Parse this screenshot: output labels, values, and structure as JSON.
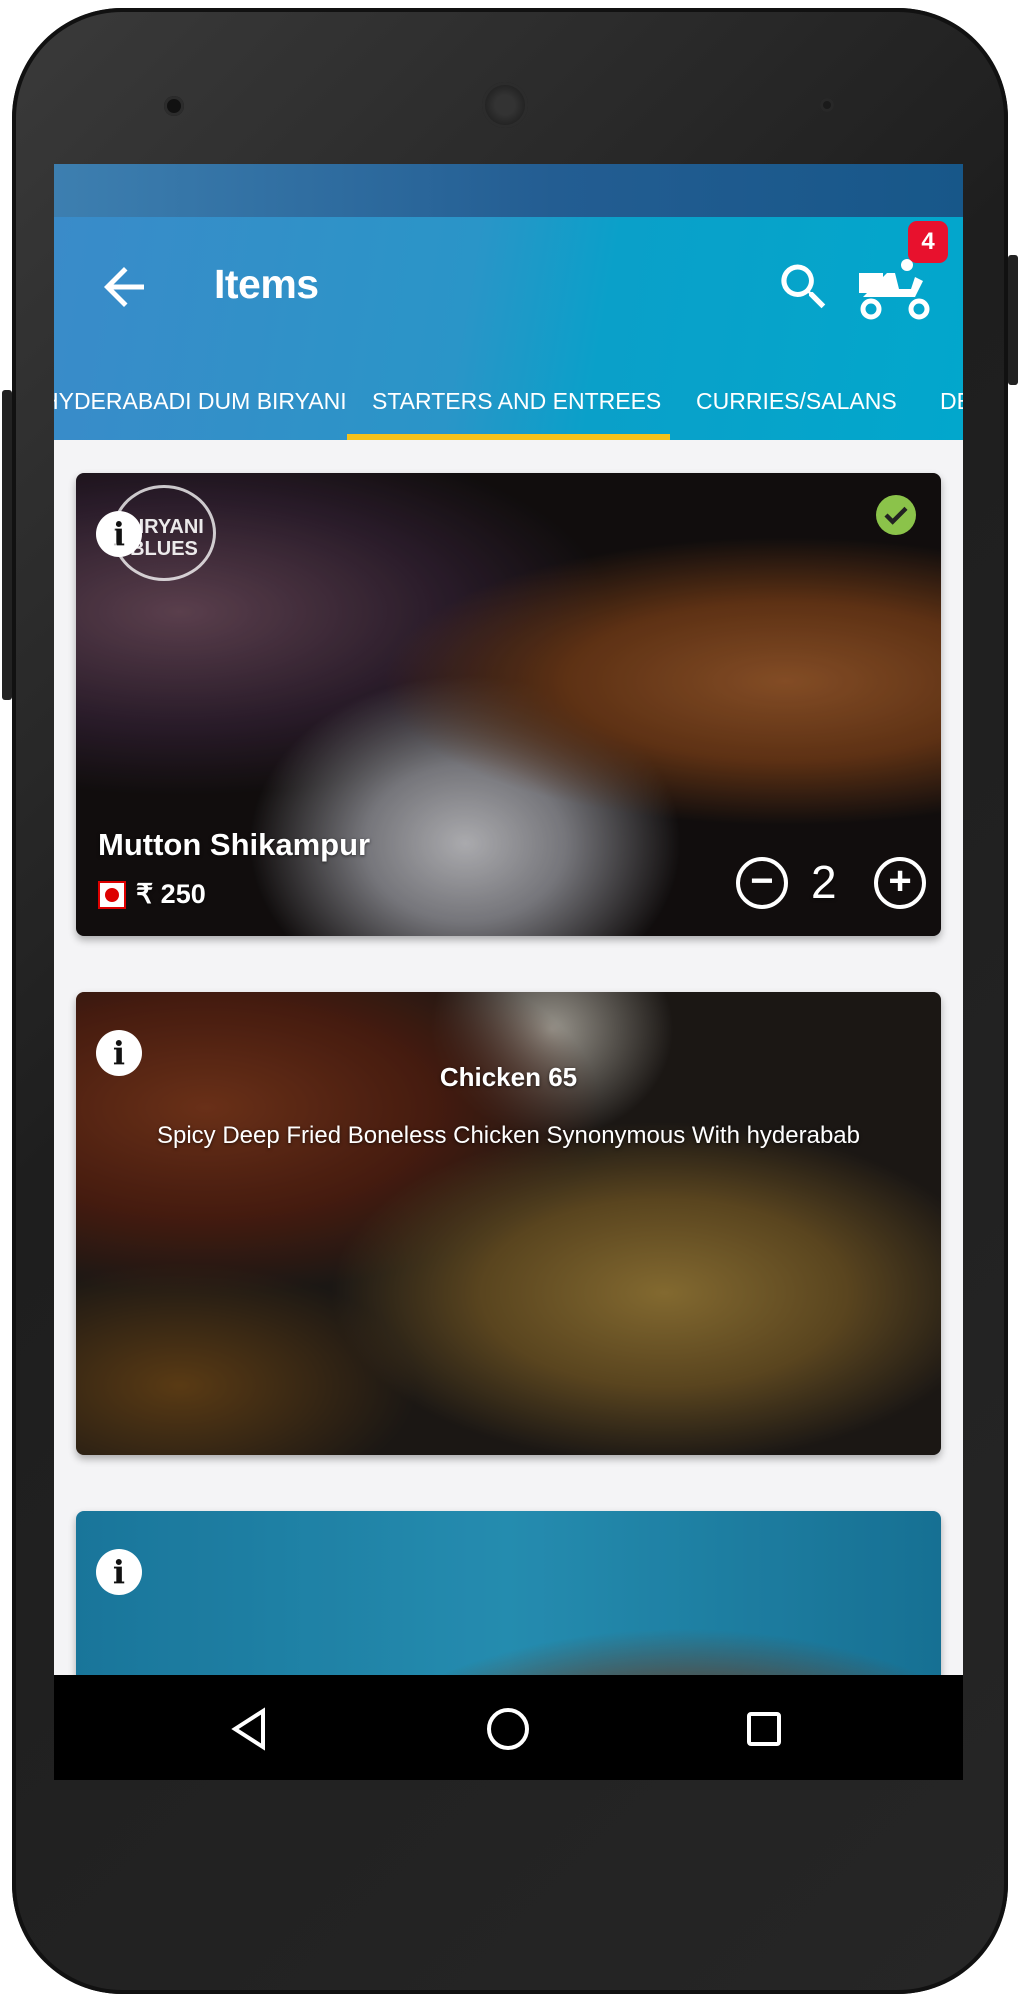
{
  "status_bar": {},
  "app_bar": {
    "title": "Items",
    "cart_badge": "4",
    "icons": [
      "back-arrow-icon",
      "search-icon",
      "delivery-scooter-icon"
    ]
  },
  "tabs": [
    {
      "label": "HYDERABADI DUM BIRYANI",
      "selected": false
    },
    {
      "label": "STARTERS AND ENTREES",
      "selected": true
    },
    {
      "label": "CURRIES/SALANS",
      "selected": false
    },
    {
      "label": "DE",
      "selected": false
    }
  ],
  "colors": {
    "accent": "#f6c21a",
    "badge": "#e8112d",
    "check": "#8bc34a",
    "appbar": "#0aa0c9"
  },
  "items": [
    {
      "name": "Mutton Shikampur",
      "price": "₹ 250",
      "quantity": "2",
      "selected": true,
      "logo": "BIRYANI BLUES"
    },
    {
      "name": "Chicken 65",
      "description": "Spicy Deep Fried Boneless Chicken Synonymous With hyderabab"
    },
    {}
  ]
}
